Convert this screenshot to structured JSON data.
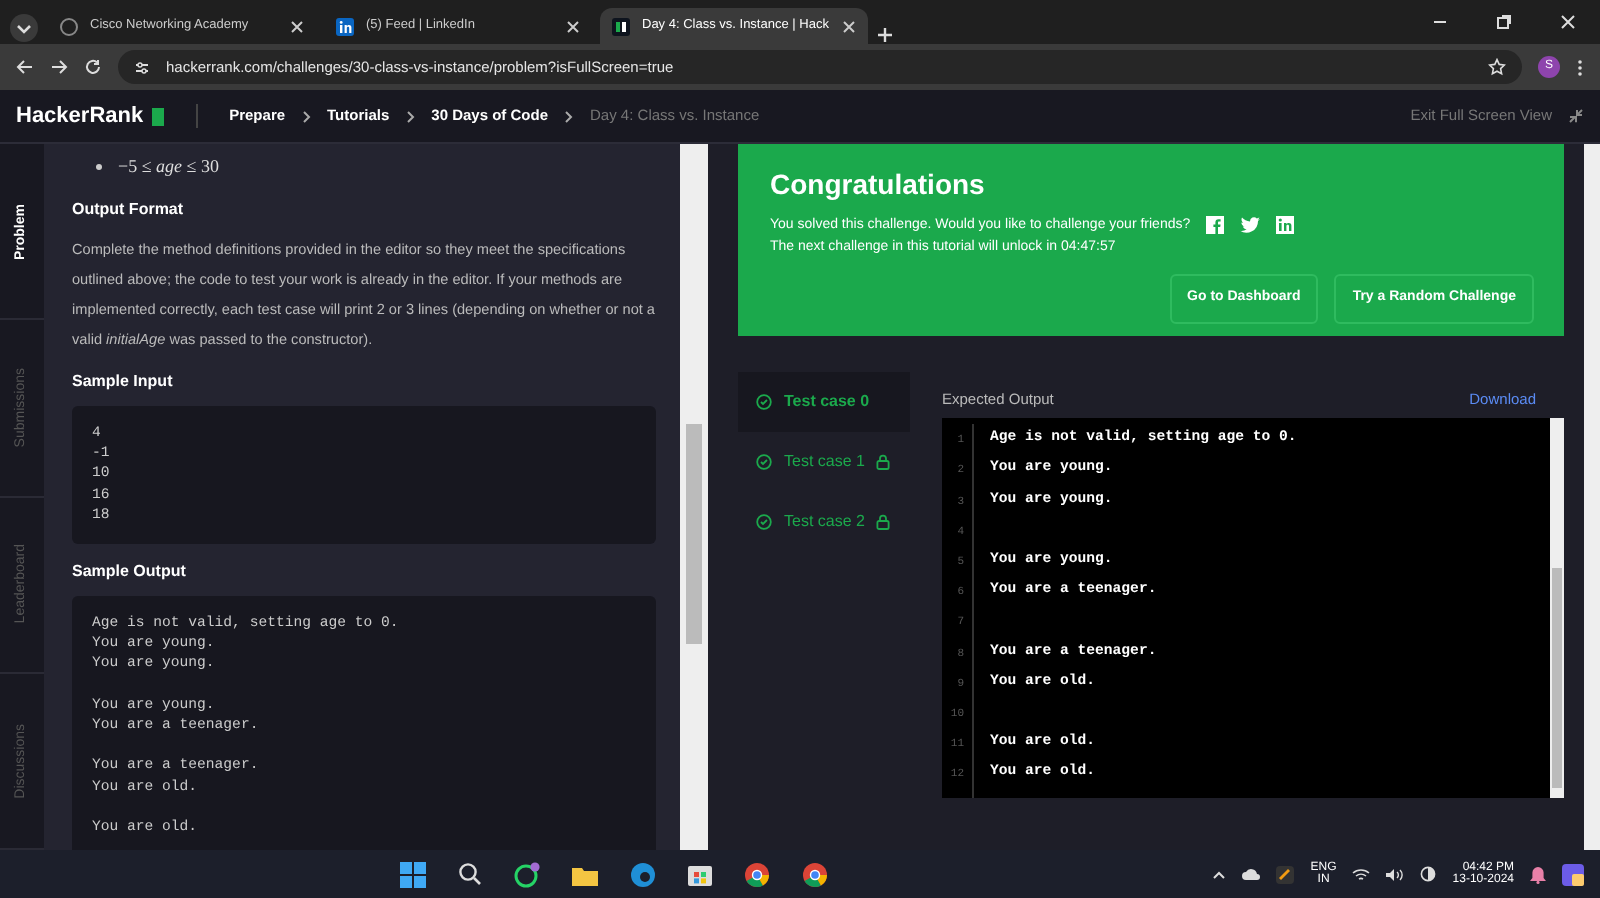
{
  "browser": {
    "tabs": [
      {
        "title": "Cisco Networking Academy",
        "selected": false
      },
      {
        "title": "(5) Feed | LinkedIn",
        "selected": false
      },
      {
        "title": "Day 4: Class vs. Instance | Hack",
        "selected": true
      }
    ],
    "url": "hackerrank.com/challenges/30-class-vs-instance/problem?isFullScreen=true",
    "profile": "S"
  },
  "header": {
    "logo": "HackerRank",
    "breadcrumbs": [
      {
        "label": "Prepare",
        "current": false
      },
      {
        "label": "Tutorials",
        "current": false
      },
      {
        "label": "30 Days of Code",
        "current": false
      },
      {
        "label": "Day 4: Class vs. Instance",
        "current": true
      }
    ],
    "exit": "Exit Full Screen View"
  },
  "side_tabs": [
    {
      "label": "Problem",
      "selected": true
    },
    {
      "label": "Submissions",
      "selected": false
    },
    {
      "label": "Leaderboard",
      "selected": false
    },
    {
      "label": "Discussions",
      "selected": false
    }
  ],
  "problem": [
    {
      "kind": "bullet",
      "text": "−5 ≤ *age* ≤ 30"
    },
    {
      "kind": "heading",
      "text": "Output Format"
    },
    {
      "kind": "paragraph",
      "text": "Complete the method definitions provided in the editor so they meet the specifications outlined above; the code to test your work is already in the editor. If your methods are implemented correctly, each test case will print 2 or 3 lines (depending on whether or not a valid *initialAge* was passed to the constructor)."
    },
    {
      "kind": "heading",
      "text": "Sample Input"
    },
    {
      "kind": "code",
      "groups": [
        [
          "4",
          "-1",
          "10",
          "16",
          "18"
        ]
      ]
    },
    {
      "kind": "heading",
      "text": "Sample Output"
    },
    {
      "kind": "code",
      "groups": [
        [
          "Age is not valid, setting age to 0.",
          "You are young.",
          "You are young."
        ],
        [
          "You are young.",
          "You are a teenager."
        ],
        [
          "You are a teenager.",
          "You are old."
        ],
        [
          "You are old."
        ]
      ]
    }
  ],
  "result": {
    "title": "Congratulations",
    "message": "You solved this challenge. Would you like to challenge your friends?",
    "unlock": "The next challenge in this tutorial will unlock in 04:47:57",
    "buttons": [
      "Go to Dashboard",
      "Try a Random Challenge"
    ]
  },
  "test_cases": [
    {
      "label": "Test case 0",
      "selected": true,
      "locked": false
    },
    {
      "label": "Test case 1",
      "selected": false,
      "locked": true
    },
    {
      "label": "Test case 2",
      "selected": false,
      "locked": true
    }
  ],
  "expected_output": {
    "label": "Expected Output",
    "download": "Download",
    "lines": [
      {
        "number": "1",
        "text": "Age is not valid, setting age to 0."
      },
      {
        "number": "2",
        "text": "You are young."
      },
      {
        "number": "3",
        "text": "You are young."
      },
      {
        "number": "4"
      },
      {
        "number": "5",
        "text": "You are young."
      },
      {
        "number": "6",
        "text": "You are a teenager."
      },
      {
        "number": "7"
      },
      {
        "number": "8",
        "text": "You are a teenager."
      },
      {
        "number": "9",
        "text": "You are old."
      },
      {
        "number": "10"
      },
      {
        "number": "11",
        "text": "You are old."
      },
      {
        "number": "12",
        "text": "You are old."
      }
    ]
  },
  "taskbar": {
    "language": "ENG",
    "region": "IN",
    "time": "04:42 PM",
    "date": "13-10-2024"
  }
}
